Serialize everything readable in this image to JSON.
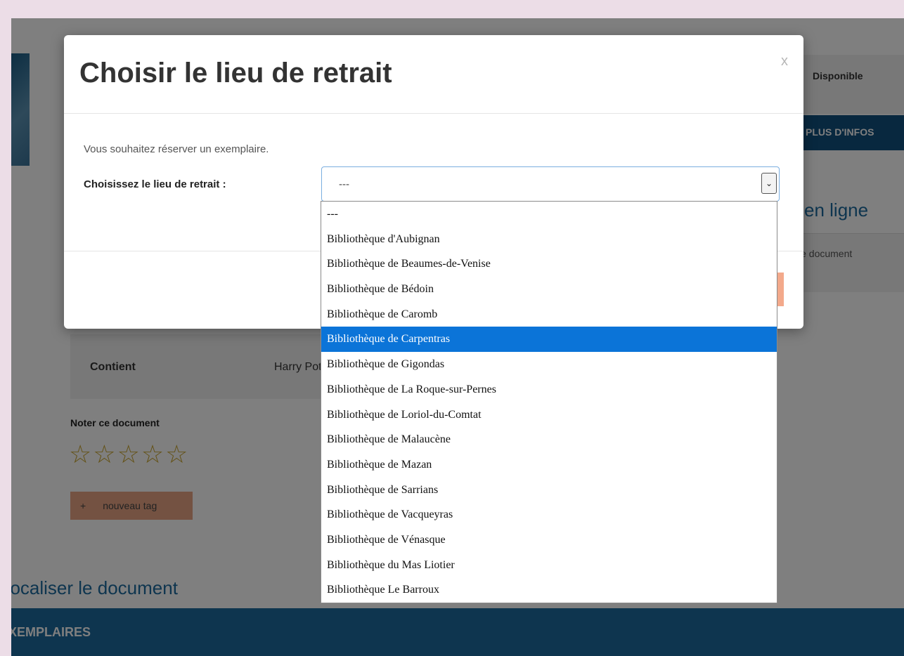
{
  "background": {
    "availability_text": "Disponible",
    "infos_button": "PLUS D'INFOS",
    "online_title": "en ligne",
    "online_text": "le document",
    "contient_label": "Contient",
    "contient_value": "Harry Potter",
    "rate_label": "Noter ce document",
    "stars": [
      "☆",
      "☆",
      "☆",
      "☆",
      "☆"
    ],
    "tag_button_plus": "+",
    "tag_button_label": "nouveau tag",
    "document_link": "Localiser le document",
    "footer_label": "EXEMPLAIRES"
  },
  "modal": {
    "title": "Choisir le lieu de retrait",
    "close_label": "x",
    "intro": "Vous souhaitez réserver un exemplaire.",
    "field_label": "Choisissez le lieu de retrait :",
    "select_value": "---",
    "options": [
      "---",
      "Bibliothèque d'Aubignan",
      "Bibliothèque de Beaumes-de-Venise",
      "Bibliothèque de Bédoin",
      "Bibliothèque de Caromb",
      "Bibliothèque de Carpentras",
      "Bibliothèque de Gigondas",
      "Bibliothèque de La Roque-sur-Pernes",
      "Bibliothèque de Loriol-du-Comtat",
      "Bibliothèque de Malaucène",
      "Bibliothèque de Mazan",
      "Bibliothèque de Sarrians",
      "Bibliothèque de Vacqueyras",
      "Bibliothèque de Vénasque",
      "Bibliothèque du Mas Liotier",
      "Bibliothèque Le Barroux"
    ],
    "highlighted_option": "Bibliothèque de Carpentras"
  },
  "colors": {
    "accent": "#1c6a9e",
    "dark_accent": "#11507e",
    "tag": "#e9a585",
    "highlight": "#0b74d8",
    "star": "#c8a52f"
  }
}
